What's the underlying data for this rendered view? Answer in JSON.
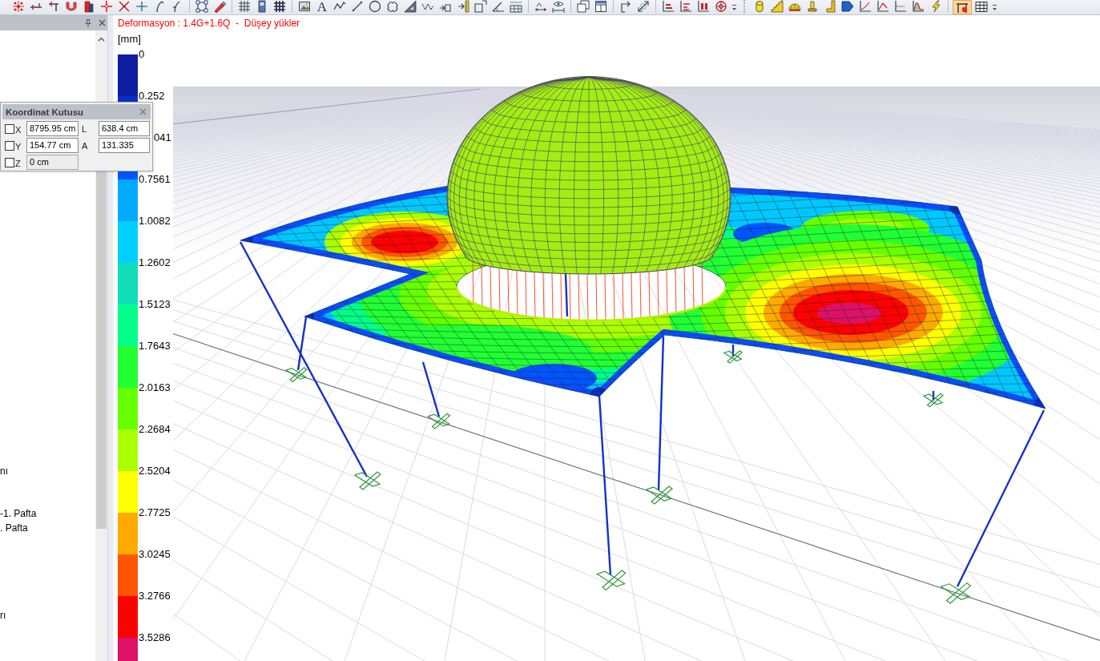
{
  "toolbar": {
    "text_button": "A",
    "toggle": {
      "selected": true
    }
  },
  "side_panel": {
    "tree_items": [
      "nı",
      "-1. Pafta",
      ". Pafta",
      "rı"
    ]
  },
  "coordinate_box": {
    "title": "Koordinat Kutusu",
    "rows": [
      {
        "axis": "X",
        "checked": false,
        "value": "8795.95 cm",
        "disabled": false
      },
      {
        "axis": "Y",
        "checked": false,
        "value": "154.77 cm",
        "disabled": false
      },
      {
        "axis": "Z",
        "checked": false,
        "value": "0 cm",
        "disabled": true
      }
    ],
    "measures": [
      {
        "label": "L",
        "value": "638.4 cm"
      },
      {
        "label": "A",
        "value": "131.335"
      }
    ]
  },
  "viewport": {
    "title": "Deformasyon : 1.4G+1.6Q  -  Düşey yükler",
    "unit": "[mm]",
    "legend": [
      {
        "label": "0",
        "color": "#0c1e9e"
      },
      {
        "label": "0.252",
        "color": "#0b2dc2"
      },
      {
        "label": "041",
        "color": "#0055ff"
      },
      {
        "label": "0.7561",
        "color": "#00aaff"
      },
      {
        "label": "1.0082",
        "color": "#00d0ff"
      },
      {
        "label": "1.2602",
        "color": "#11ddbb"
      },
      {
        "label": "1.5123",
        "color": "#00ff88"
      },
      {
        "label": "1.7643",
        "color": "#22ff33"
      },
      {
        "label": "2.0163",
        "color": "#66ff00"
      },
      {
        "label": "2.2684",
        "color": "#aaff00"
      },
      {
        "label": "2.5204",
        "color": "#ffff00"
      },
      {
        "label": "2.7725",
        "color": "#ffaa00"
      },
      {
        "label": "3.0245",
        "color": "#ff5500"
      },
      {
        "label": "3.2766",
        "color": "#ff0000"
      },
      {
        "label": "3.5286",
        "color": "#dd1166"
      }
    ]
  }
}
